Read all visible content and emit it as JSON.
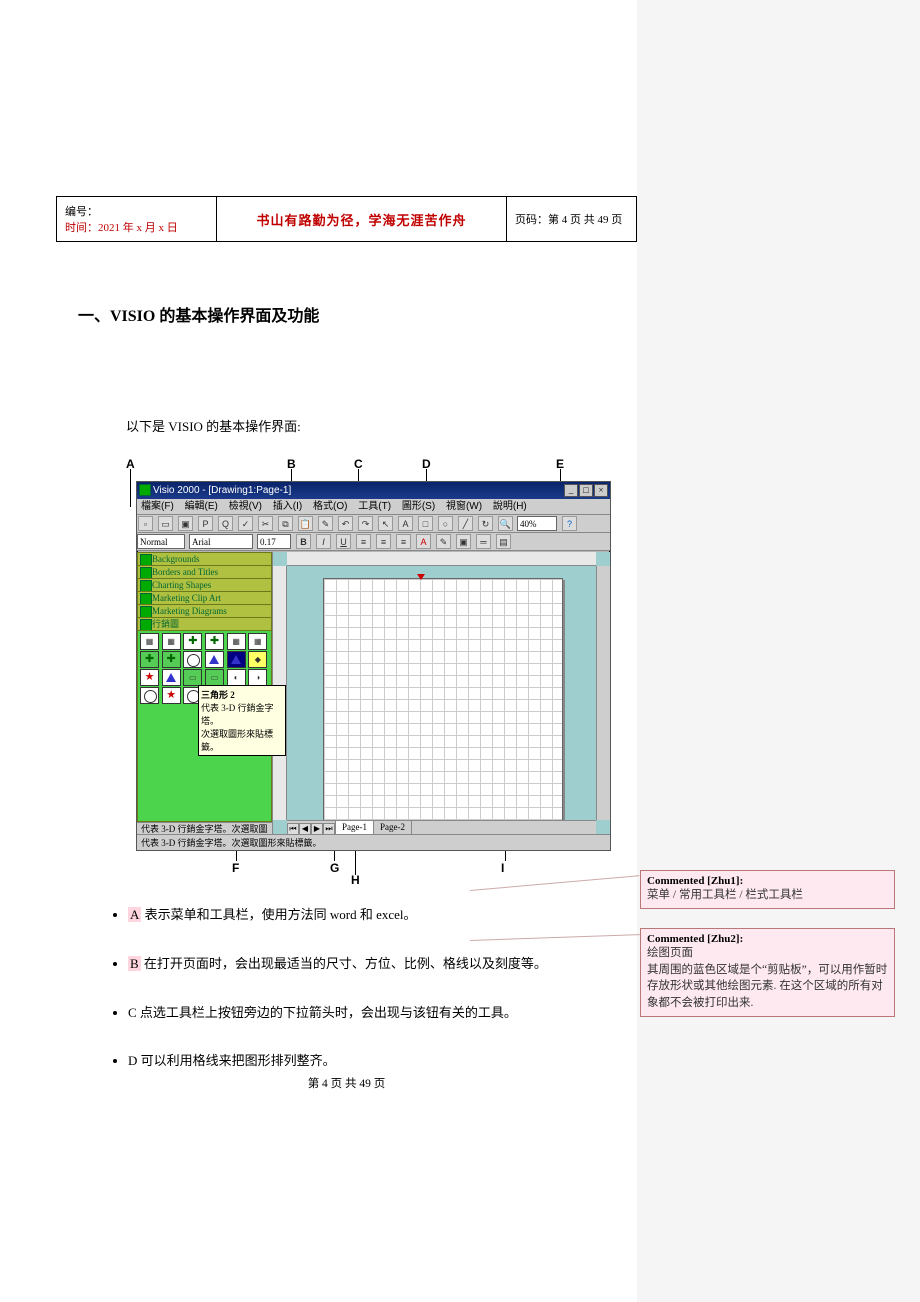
{
  "header": {
    "left_line1": "编号：",
    "left_line2": "时间：2021 年 x 月 x 日",
    "mid": "书山有路勤为径，学海无涯苦作舟",
    "right": "页码：第 4 页  共 49 页"
  },
  "heading": "一、VISIO 的基本操作界面及功能",
  "intro": "以下是 VISIO 的基本操作界面:",
  "labels": {
    "A": "A",
    "B": "B",
    "C": "C",
    "D": "D",
    "E": "E",
    "F": "F",
    "G": "G",
    "H": "H",
    "I": "I"
  },
  "visio": {
    "title": "Visio 2000 - [Drawing1:Page-1]",
    "menus": [
      "檔案(F)",
      "編輯(E)",
      "檢視(V)",
      "插入(I)",
      "格式(O)",
      "工具(T)",
      "圖形(S)",
      "視窗(W)",
      "說明(H)"
    ],
    "zoom": "40%",
    "fmt_style": "Normal",
    "fmt_font": "Arial",
    "fmt_size": "0.17",
    "stencils": [
      "Backgrounds",
      "Borders and Titles",
      "Charting Shapes",
      "Marketing Clip Art",
      "Marketing Diagrams",
      "行銷圖"
    ],
    "tooltip_title": "三角形 2",
    "tooltip_body": "代表 3-D 行銷金字塔。\n次選取圖形來貼標籤。",
    "page_tab1": "Page-1",
    "page_tab2": "Page-2",
    "status": "代表 3-D 行銷金字塔。次選取圖形來貼標籤。"
  },
  "bullets": {
    "a_hl": "A",
    "a_rest": " 表示菜单和工具栏，使用方法同 word 和 excel。",
    "b_hl": "B",
    "b_rest": " 在打开页面时，会出现最适当的尺寸、方位、比例、格线以及刻度等。",
    "c": "C 点选工具栏上按钮旁边的下拉箭头时，会出现与该钮有关的工具。",
    "d": "D 可以利用格线来把图形排列整齐。"
  },
  "comments": {
    "c1_title": "Commented [Zhu1]:",
    "c1_body": "菜单 / 常用工具栏 / 栏式工具栏",
    "c2_title": "Commented [Zhu2]:",
    "c2_body": "绘图页面\n其周围的蓝色区域是个“剪贴板”，可以用作暂时存放形状或其他绘图元素. 在这个区域的所有对象都不会被打印出来."
  },
  "footer": "第  4  页  共  49  页"
}
